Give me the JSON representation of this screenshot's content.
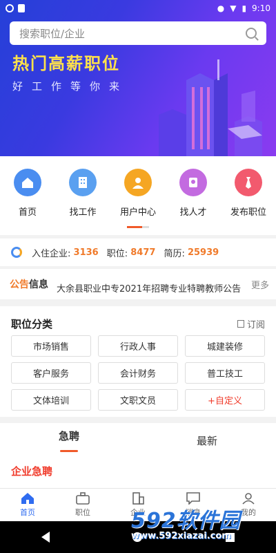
{
  "status_bar": {
    "time": "9:10"
  },
  "search": {
    "placeholder": "搜索职位/企业"
  },
  "hero": {
    "title": "热门高薪职位",
    "subtitle": "好工作等你来"
  },
  "quick_nav": [
    {
      "label": "首页",
      "icon": "home-icon",
      "color": "#4a8df0"
    },
    {
      "label": "找工作",
      "icon": "building-icon",
      "color": "#5aa0f0"
    },
    {
      "label": "用户中心",
      "icon": "user-icon",
      "color": "#f5a623"
    },
    {
      "label": "找人才",
      "icon": "talent-icon",
      "color": "#c36be0"
    },
    {
      "label": "发布职位",
      "icon": "tie-icon",
      "color": "#f25a6e"
    }
  ],
  "stats": {
    "companies_label": "入住企业:",
    "companies": "3136",
    "jobs_label": "职位:",
    "jobs": "8477",
    "resumes_label": "简历:",
    "resumes": "25939"
  },
  "notice": {
    "title_part1": "公告",
    "title_part2": "信息",
    "text": "大余县职业中专2021年招聘专业特聘教师公告",
    "more": "更多"
  },
  "categories": {
    "title": "职位分类",
    "subscribe": "订阅",
    "items": [
      "市场销售",
      "行政人事",
      "城建装修",
      "客户服务",
      "会计财务",
      "普工技工",
      "文体培训",
      "文职文员",
      "+自定义"
    ]
  },
  "tabs": [
    "急聘",
    "最新"
  ],
  "urgent": {
    "title": "企业急聘"
  },
  "bottom_nav": [
    {
      "label": "首页",
      "icon": "home-icon"
    },
    {
      "label": "职位",
      "icon": "briefcase-icon"
    },
    {
      "label": "企业",
      "icon": "company-icon"
    },
    {
      "label": "消息",
      "icon": "message-icon"
    },
    {
      "label": "我的",
      "icon": "profile-icon"
    }
  ],
  "watermark": {
    "brand": "592软件园",
    "url": "www.592xiazai.com"
  }
}
